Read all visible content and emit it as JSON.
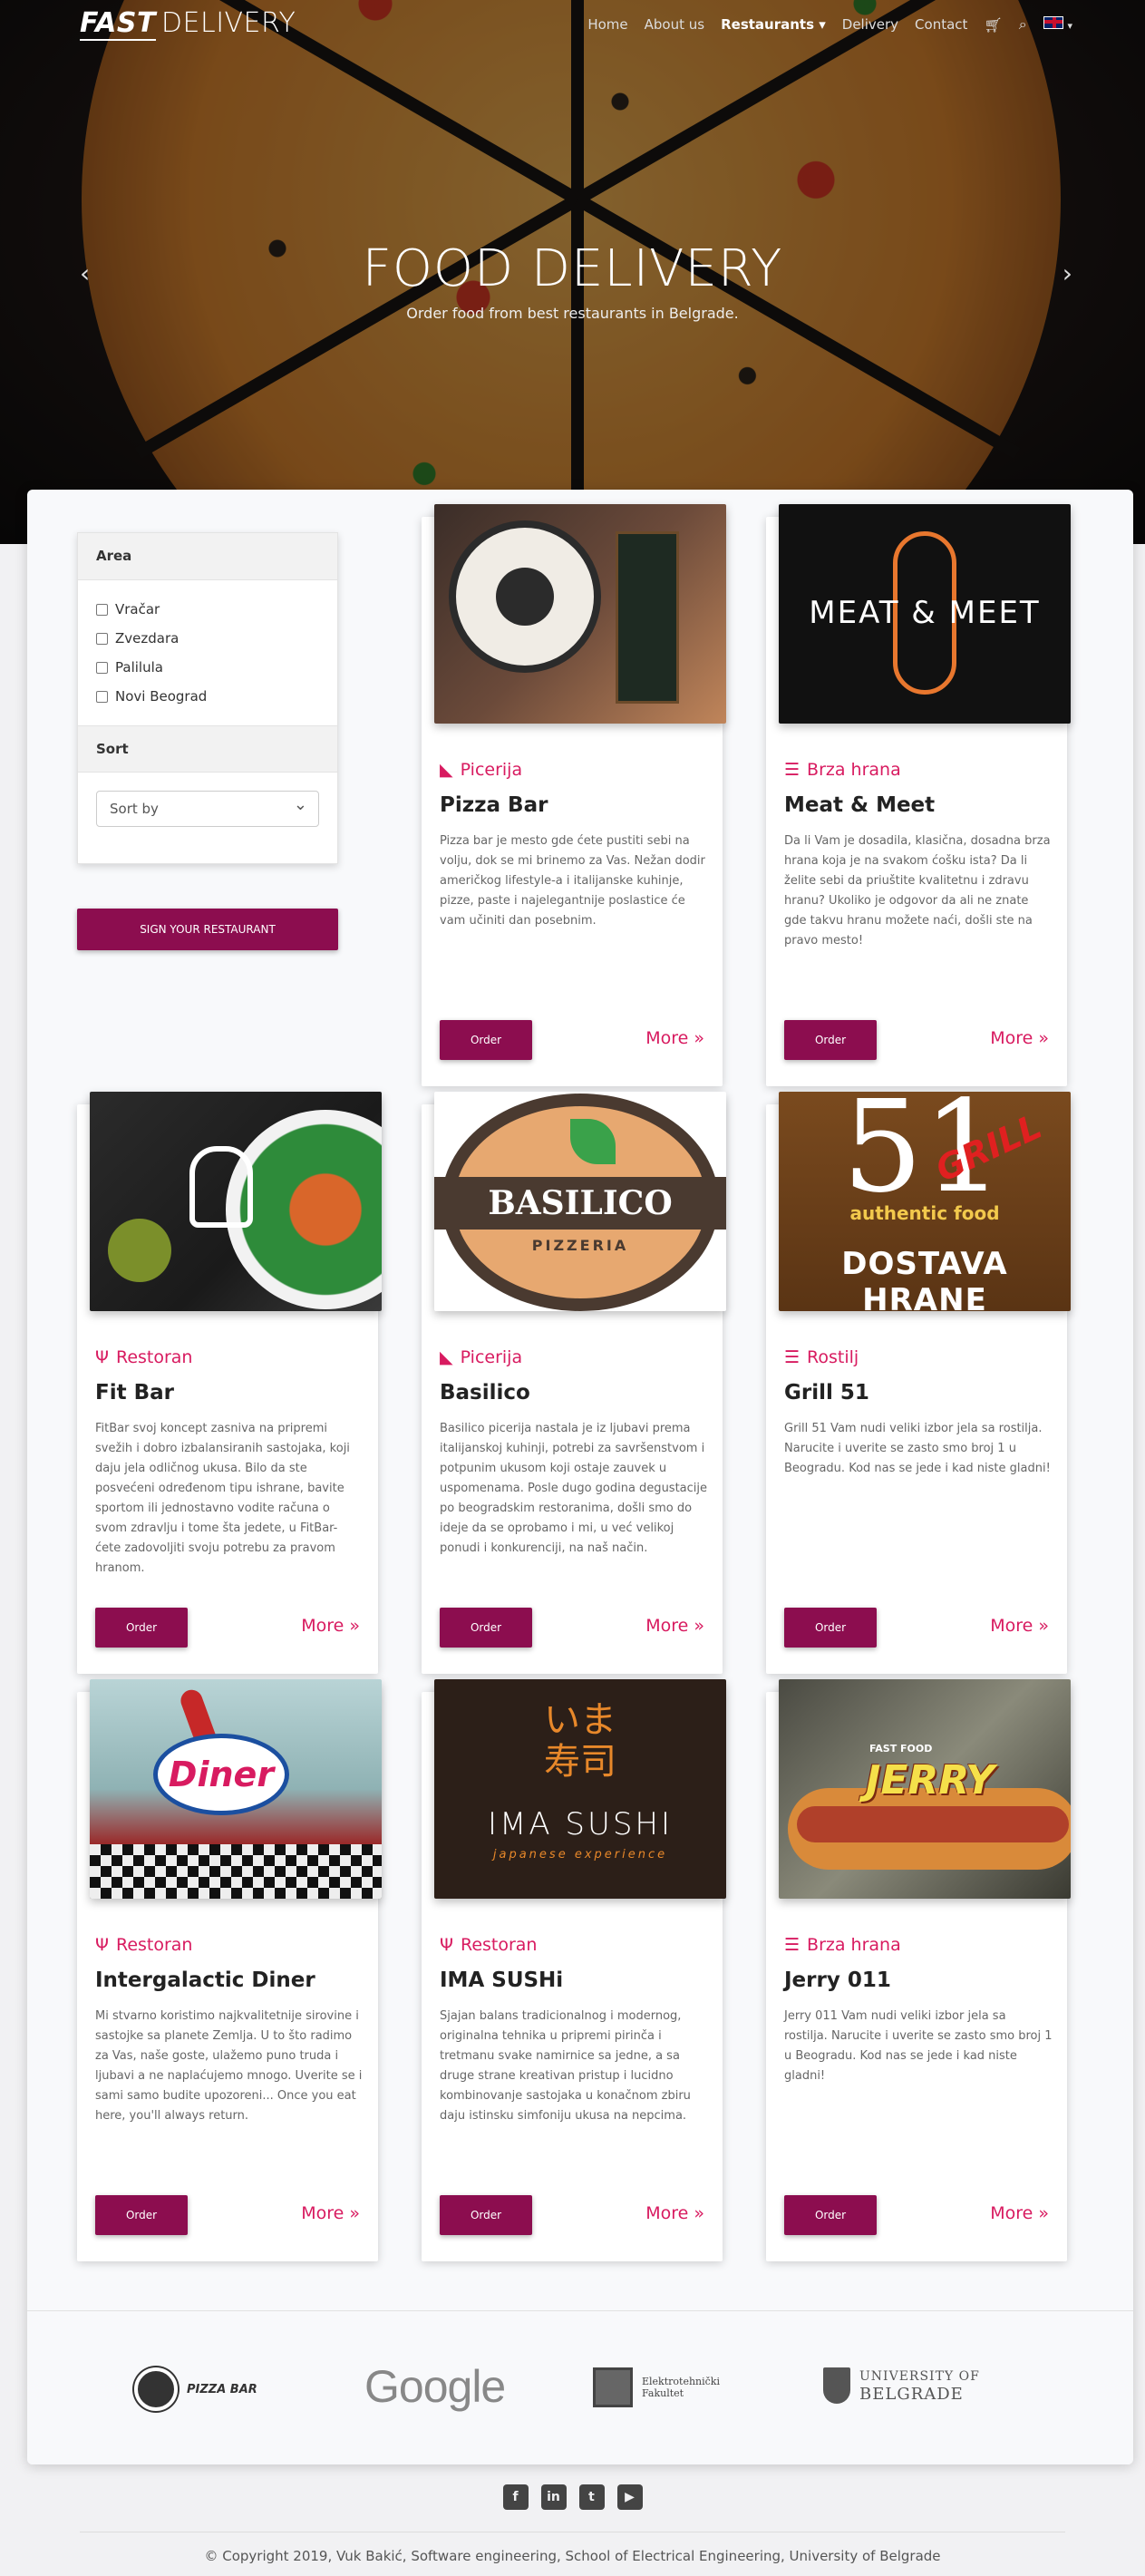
{
  "nav": {
    "brand_bold": "FAST",
    "brand_light": "DELIVERY",
    "links": [
      "Home",
      "About us",
      "Restaurants",
      "Delivery",
      "Contact"
    ],
    "active": "Restaurants",
    "icons": [
      "cart-icon",
      "search-icon",
      "flag-uk-icon"
    ]
  },
  "hero": {
    "title": "FOOD DELIVERY",
    "subtitle": "Order food from best restaurants in Belgrade.",
    "prev": "‹",
    "next": "›"
  },
  "filter": {
    "area_label": "Area",
    "areas": [
      "Vračar",
      "Zvezdara",
      "Palilula",
      "Novi Beograd"
    ],
    "sort_label": "Sort",
    "sort_value": "Sort by",
    "sign_button": "SIGN YOUR RESTAURANT"
  },
  "cards": [
    {
      "category": "Picerija",
      "cat_icon": "pizza-icon",
      "name": "Pizza Bar",
      "desc": "Pizza bar je mesto gde ćete pustiti sebi na volju, dok se mi brinemo za Vas. Nežan dodir američkog lifestyle-a i italijanske kuhinje, pizze, paste i najelegantnije poslastice će vam učiniti dan posebnim."
    },
    {
      "category": "Brza hrana",
      "cat_icon": "burger-icon",
      "name": "Meat & Meet",
      "desc": "Da li Vam je dosadila, klasična, dosadna brza hrana koja je na svakom ćošku ista? Da li želite sebi da priuštite kvalitetnu i zdravu hranu? Ukoliko je odgovor da ali ne znate gde takvu hranu možete naći, došli ste na pravo mesto!"
    },
    {
      "category": "Restoran",
      "cat_icon": "utensils-icon",
      "name": "Fit Bar",
      "desc": "FitBar svoj koncept zasniva na pripremi svežih i dobro izbalansiranih sastojaka, koji daju jela odličnog ukusa. Bilo da ste posvećeni određenom tipu ishrane, bavite sportom ili jednostavno vodite računa o svom zdravlju i tome šta jedete, u FitBar- ćete zadovoljiti svoju potrebu za pravom hranom."
    },
    {
      "category": "Picerija",
      "cat_icon": "pizza-icon",
      "name": "Basilico",
      "desc": "Basilico picerija nastala je iz ljubavi prema italijanskoj kuhinji, potrebi za savršenstvom i potpunim ukusom koji ostaje zauvek u uspomenama. Posle dugo godina degustacije po beogradskim restoranima, došli smo do ideje da se oprobamo i mi, u već velikoj ponudi i konkurenciji, na naš način."
    },
    {
      "category": "Rostilj",
      "cat_icon": "burger-icon",
      "name": "Grill 51",
      "desc": "Grill 51 Vam nudi veliki izbor jela sa rostilja. Narucite i uverite se zasto smo broj 1 u Beogradu. Kod nas se jede i kad niste gladni!"
    },
    {
      "category": "Brza hrana",
      "cat_icon": "burger-icon",
      "name": "Jerry 011",
      "desc": "Jerry 011 Vam nudi veliki izbor jela sa rostilja. Narucite i uverite se zasto smo broj 1 u Beogradu. Kod nas se jede i kad niste gladni!"
    },
    {
      "category": "Restoran",
      "cat_icon": "utensils-icon",
      "name": "Intergalactic Diner",
      "desc": "Mi stvarno koristimo najkvalitetnije sirovine i sastojke sa planete Zemlja. U to što radimo za Vas, naše goste, ulažemo puno truda i ljubavi a ne naplaćujemo mnogo. Uverite se i sami samo budite upozoreni... Once you eat here, you'll always return."
    },
    {
      "category": "Restoran",
      "cat_icon": "utensils-icon",
      "name": "IMA SUSHi",
      "desc": "Sjajan balans tradicionalnog i modernog, originalna tehnika u pripremi pirinča i tretmanu svake namirnice sa jedne, a sa druge strane kreativan pristup i lucidno kombinovanje sastojaka u konačnom zbiru daju istinsku simfoniju ukusa na nepcima."
    }
  ],
  "card_buttons": {
    "order": "Order",
    "more": "More »"
  },
  "thumbs": {
    "meat": "MEAT & MEET",
    "basilico": "BASILICO",
    "basilico_sub": "PIZZERIA",
    "grill_num": "51",
    "grill_word": "GRILL",
    "grill_af": "authentic food",
    "grill_dh": "DOSTAVA HRANE",
    "diner": "Diner",
    "sushi_jp": "いま\n寿司",
    "sushi": "IMA SUSHI",
    "sushi_exp": "japanese experience",
    "jerry_ff": "FAST FOOD",
    "jerry": "JERRY"
  },
  "partners": {
    "pizza": "PIZZA BAR",
    "google": "Google",
    "etf_1": "Elektrotehnički",
    "etf_2": "Fakultet",
    "bg_1": "UNIVERSITY OF",
    "bg_2": "BELGRADE"
  },
  "footer": {
    "social": [
      "facebook-icon",
      "linkedin-icon",
      "twitter-icon",
      "youtube-icon"
    ],
    "copyright": "© Copyright 2019, Vuk Bakić, Software engineering, School of Electrical Engineering, University of Belgrade"
  },
  "colors": {
    "accent": "#8c0d4f",
    "category": "#d81b60"
  }
}
